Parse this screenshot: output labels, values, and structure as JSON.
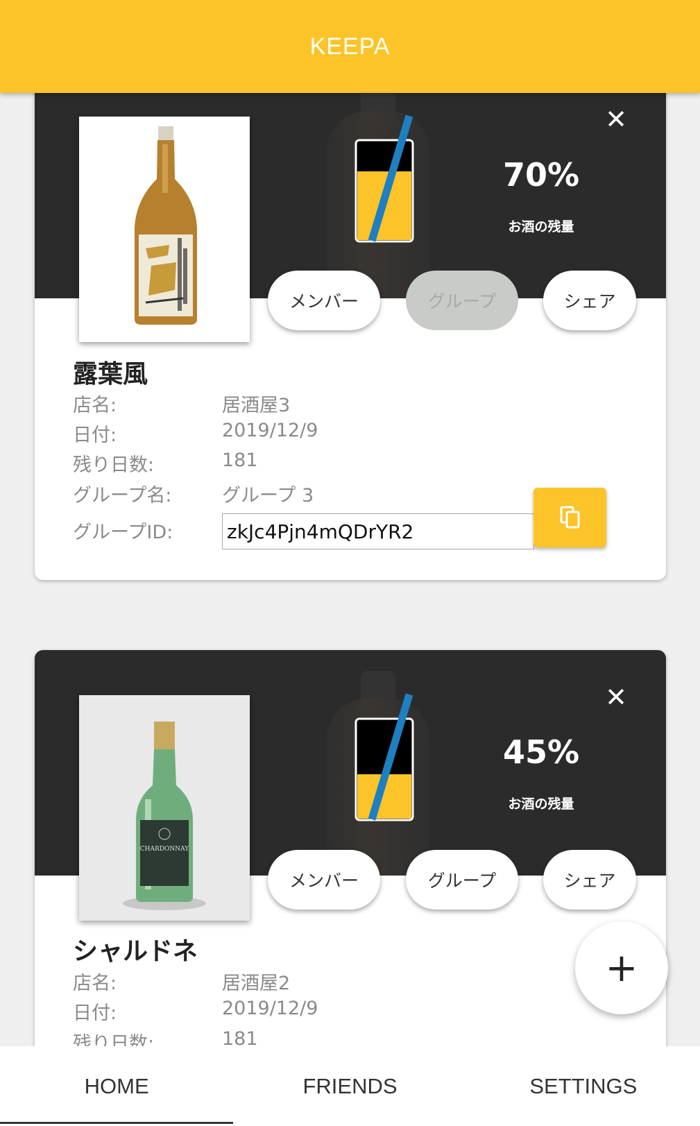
{
  "header": {
    "title": "KEEPA"
  },
  "cards": [
    {
      "percent": "70%",
      "percent_value": 0.7,
      "remaining_label": "お酒の残量",
      "buttons": {
        "member": "メンバー",
        "group": "グループ",
        "share": "シェア"
      },
      "group_disabled": true,
      "name": "露葉風",
      "fields": [
        {
          "key": "店名:",
          "value": "居酒屋3"
        },
        {
          "key": "日付:",
          "value": "2019/12/9"
        },
        {
          "key": "残り日数:",
          "value": "181"
        },
        {
          "key": "グループ名:",
          "value": "グループ 3"
        },
        {
          "key": "グループID:",
          "value": "zkJc4Pjn4mQDrYR2"
        }
      ]
    },
    {
      "percent": "45%",
      "percent_value": 0.45,
      "remaining_label": "お酒の残量",
      "buttons": {
        "member": "メンバー",
        "group": "グループ",
        "share": "シェア"
      },
      "group_disabled": false,
      "name": "シャルドネ",
      "fields": [
        {
          "key": "店名:",
          "value": "居酒屋2"
        },
        {
          "key": "日付:",
          "value": "2019/12/9"
        },
        {
          "key": "残り日数:",
          "value": "181"
        }
      ]
    }
  ],
  "fab": {
    "label": "+"
  },
  "nav": {
    "home": "HOME",
    "friends": "FRIENDS",
    "settings": "SETTINGS",
    "active": "home"
  },
  "colors": {
    "accent": "#fcc428",
    "straw": "#1e7fc1",
    "dark": "#2b2b2b"
  }
}
